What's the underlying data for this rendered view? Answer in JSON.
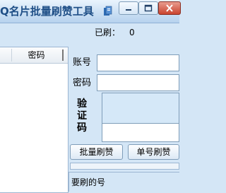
{
  "window": {
    "title": "Q名片批量刷赞工具",
    "controls": {
      "minimize": "minimize-icon",
      "maximize": "maximize-icon",
      "close": "close-icon"
    }
  },
  "status": {
    "brushed_label": "已刷：",
    "brushed_count": "0"
  },
  "grid": {
    "columns": [
      "",
      "密码"
    ]
  },
  "form": {
    "account_label": "账号",
    "account_value": "",
    "password_label": "密码",
    "password_value": "",
    "captcha_label": "验证码",
    "captcha_value": ""
  },
  "buttons": {
    "batch_like": "批量刷赞",
    "single_like": "单号刷赞"
  },
  "progress": {
    "value": 0
  },
  "target": {
    "label": "要刷的号"
  },
  "colors": {
    "accent": "#1f4f87",
    "background": "#d4e6f6"
  }
}
